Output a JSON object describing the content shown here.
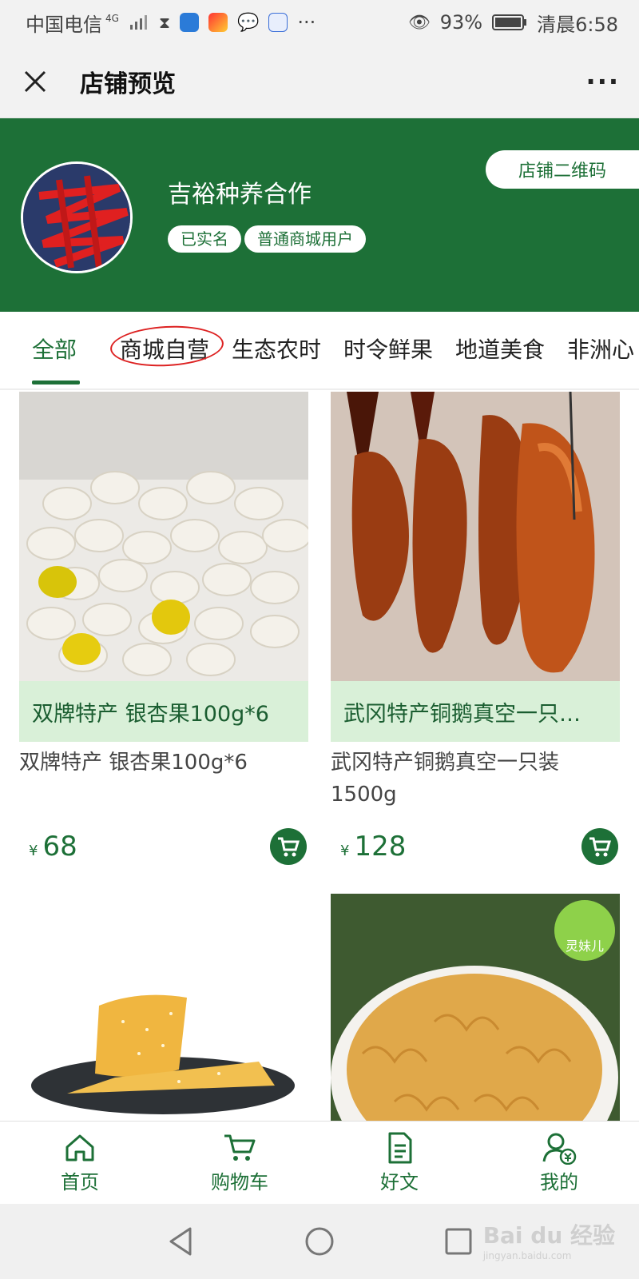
{
  "statusbar": {
    "carrier": "中国电信",
    "network": "4G",
    "battery": "93%",
    "time": "清晨6:58",
    "more": "···"
  },
  "titlebar": {
    "title": "店铺预览",
    "more": "···"
  },
  "shop": {
    "name": "吉裕种养合作",
    "tags": [
      "已实名",
      "普通商城用户"
    ],
    "qr_button": "店铺二维码"
  },
  "tabs": [
    "全部",
    "商城自营",
    "生态农时",
    "时令鲜果",
    "地道美食",
    "非洲心"
  ],
  "products": [
    {
      "overlay": "双牌特产  银杏果100g*6",
      "name": "双牌特产  银杏果100g*6",
      "currency": "¥",
      "price": "68"
    },
    {
      "overlay": "武冈特产铜鹅真空一只…",
      "name": "武冈特产铜鹅真空一只装1500g",
      "currency": "¥",
      "price": "128"
    },
    {},
    {
      "badge": "灵妹儿"
    }
  ],
  "navbar": [
    {
      "label": "首页",
      "icon": "home-icon"
    },
    {
      "label": "购物车",
      "icon": "cart-icon"
    },
    {
      "label": "好文",
      "icon": "document-icon"
    },
    {
      "label": "我的",
      "icon": "user-icon"
    }
  ],
  "watermark": {
    "brand": "Bai du 经验",
    "url": "jingyan.baidu.com"
  },
  "colors": {
    "brand": "#1d7037",
    "overlay": "#d9f0d8"
  }
}
